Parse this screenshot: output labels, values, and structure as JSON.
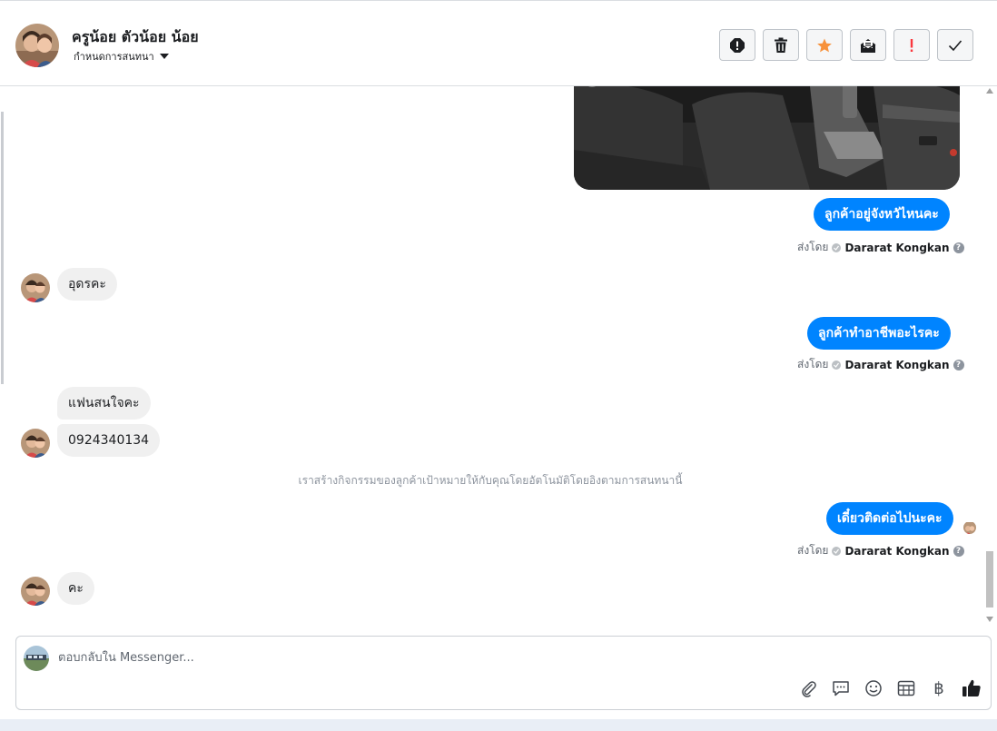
{
  "header": {
    "contact_name": "ครูน้อย ตัวน้อย น้อย",
    "assign_label": "กำหนดการสนทนา",
    "toolbar": [
      "spam-icon",
      "trash-icon",
      "star-icon",
      "mark-unread-icon",
      "important-icon",
      "done-icon"
    ]
  },
  "messages": {
    "out1": "ลูกค้าอยู่จังหวัไหนคะ",
    "in1": "อุดรคะ",
    "out2": "ลูกค้าทำอาชีพอะไรคะ",
    "in2a": "แฟนสนใจคะ",
    "in2b": "0924340134",
    "system": "เราสร้างกิจกรรมของลูกค้าเป้าหมายให้กับคุณโดยอัตโนมัติโดยอิงตามการสนทนานี้",
    "out3": "เดี๋ยวติดต่อไปนะคะ",
    "in3": "คะ"
  },
  "sent_by": {
    "prefix": "ส่งโดย",
    "agent": "Dararat Kongkan"
  },
  "composer": {
    "placeholder": "ตอบกลับใน Messenger...",
    "baht_symbol": "฿",
    "tools": [
      "attach-icon",
      "saved-reply-icon",
      "emoji-icon",
      "appointment-icon",
      "payment-icon",
      "like-icon"
    ]
  },
  "colors": {
    "accent": "#0084ff",
    "incoming": "#f0f0f0",
    "star": "#f7923b",
    "important": "#fa383e"
  }
}
